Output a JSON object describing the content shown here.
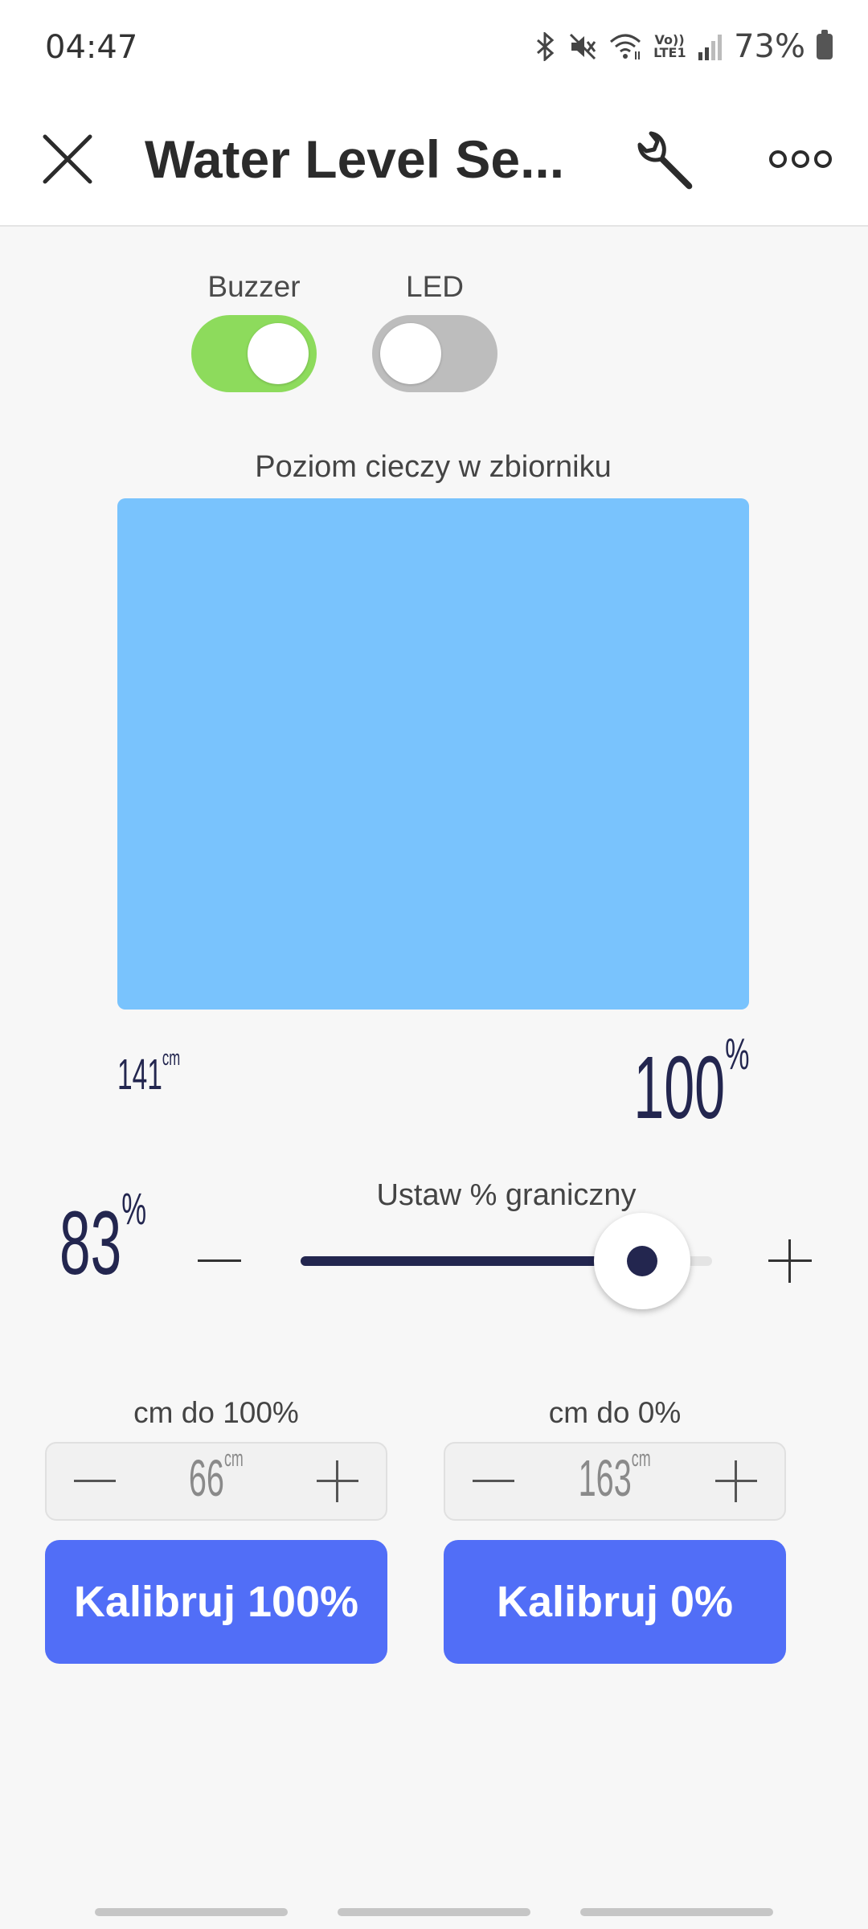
{
  "status_bar": {
    "time": "04:47",
    "battery_text": "73%",
    "volte_label": "Vo)) LTE1",
    "icons": [
      "bluetooth-icon",
      "mute-icon",
      "wifi-icon",
      "volte-icon",
      "signal-icon",
      "battery-icon"
    ]
  },
  "header": {
    "title": "Water Level Se...",
    "icons": [
      "close-icon",
      "wrench-icon",
      "more-icon"
    ]
  },
  "toggles": {
    "buzzer": {
      "label": "Buzzer",
      "on": true,
      "color": "#8ddb5c"
    },
    "led": {
      "label": "LED",
      "on": false,
      "color": "#bdbdbd"
    }
  },
  "tank": {
    "label": "Poziom cieczy w zbiorniku",
    "fill_percent": 100,
    "fill_color": "#79c3fd",
    "distance_value": "141",
    "distance_unit": "cm",
    "level_value": "100",
    "level_unit": "%"
  },
  "threshold": {
    "label": "Ustaw % graniczny",
    "value": "83",
    "unit": "%",
    "slider_fraction": 0.83
  },
  "calibration": {
    "full": {
      "label": "cm do 100%",
      "value": "66",
      "unit": "cm",
      "button": "Kalibruj 100%"
    },
    "empty": {
      "label": "cm do 0%",
      "value": "163",
      "unit": "cm",
      "button": "Kalibruj 0%"
    }
  },
  "colors": {
    "accent_dark": "#23264f",
    "button_blue": "#516ef7"
  }
}
